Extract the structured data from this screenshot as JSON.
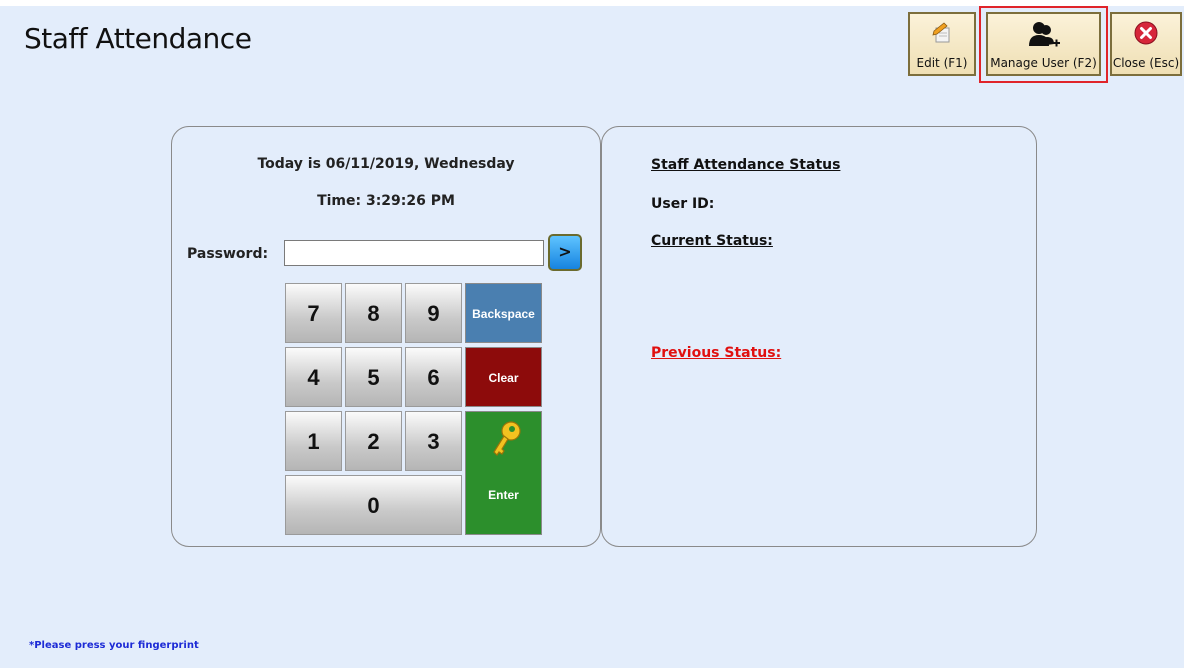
{
  "window": {
    "title": "Staff Attendance"
  },
  "toolbar": {
    "edit_label": "Edit (F1)",
    "manage_user_label": "Manage User (F2)",
    "close_label": "Close (Esc)"
  },
  "clock": {
    "date_text": "Today is 06/11/2019, Wednesday",
    "time_text": "Time: 3:29:26 PM"
  },
  "password": {
    "label": "Password:",
    "value": "",
    "go_label": ">"
  },
  "keypad": {
    "keys": [
      "7",
      "8",
      "9",
      "4",
      "5",
      "6",
      "1",
      "2",
      "3",
      "0"
    ],
    "backspace_label": "Backspace",
    "clear_label": "Clear",
    "enter_label": "Enter",
    "backspace_color": "#4a7fb0",
    "clear_color": "#8d0b0b",
    "enter_color": "#2c8f2c"
  },
  "status": {
    "heading": "Staff Attendance Status",
    "user_id_label": "User ID:",
    "current_status_label": "Current Status:",
    "previous_status_label": "Previous Status:",
    "previous_status_color": "#e01010"
  },
  "footer": {
    "hint": "*Please press your fingerprint"
  },
  "icons": {
    "edit": "pencil-document-icon",
    "manage_user": "add-user-icon",
    "close": "close-circle-icon",
    "enter": "key-icon"
  }
}
